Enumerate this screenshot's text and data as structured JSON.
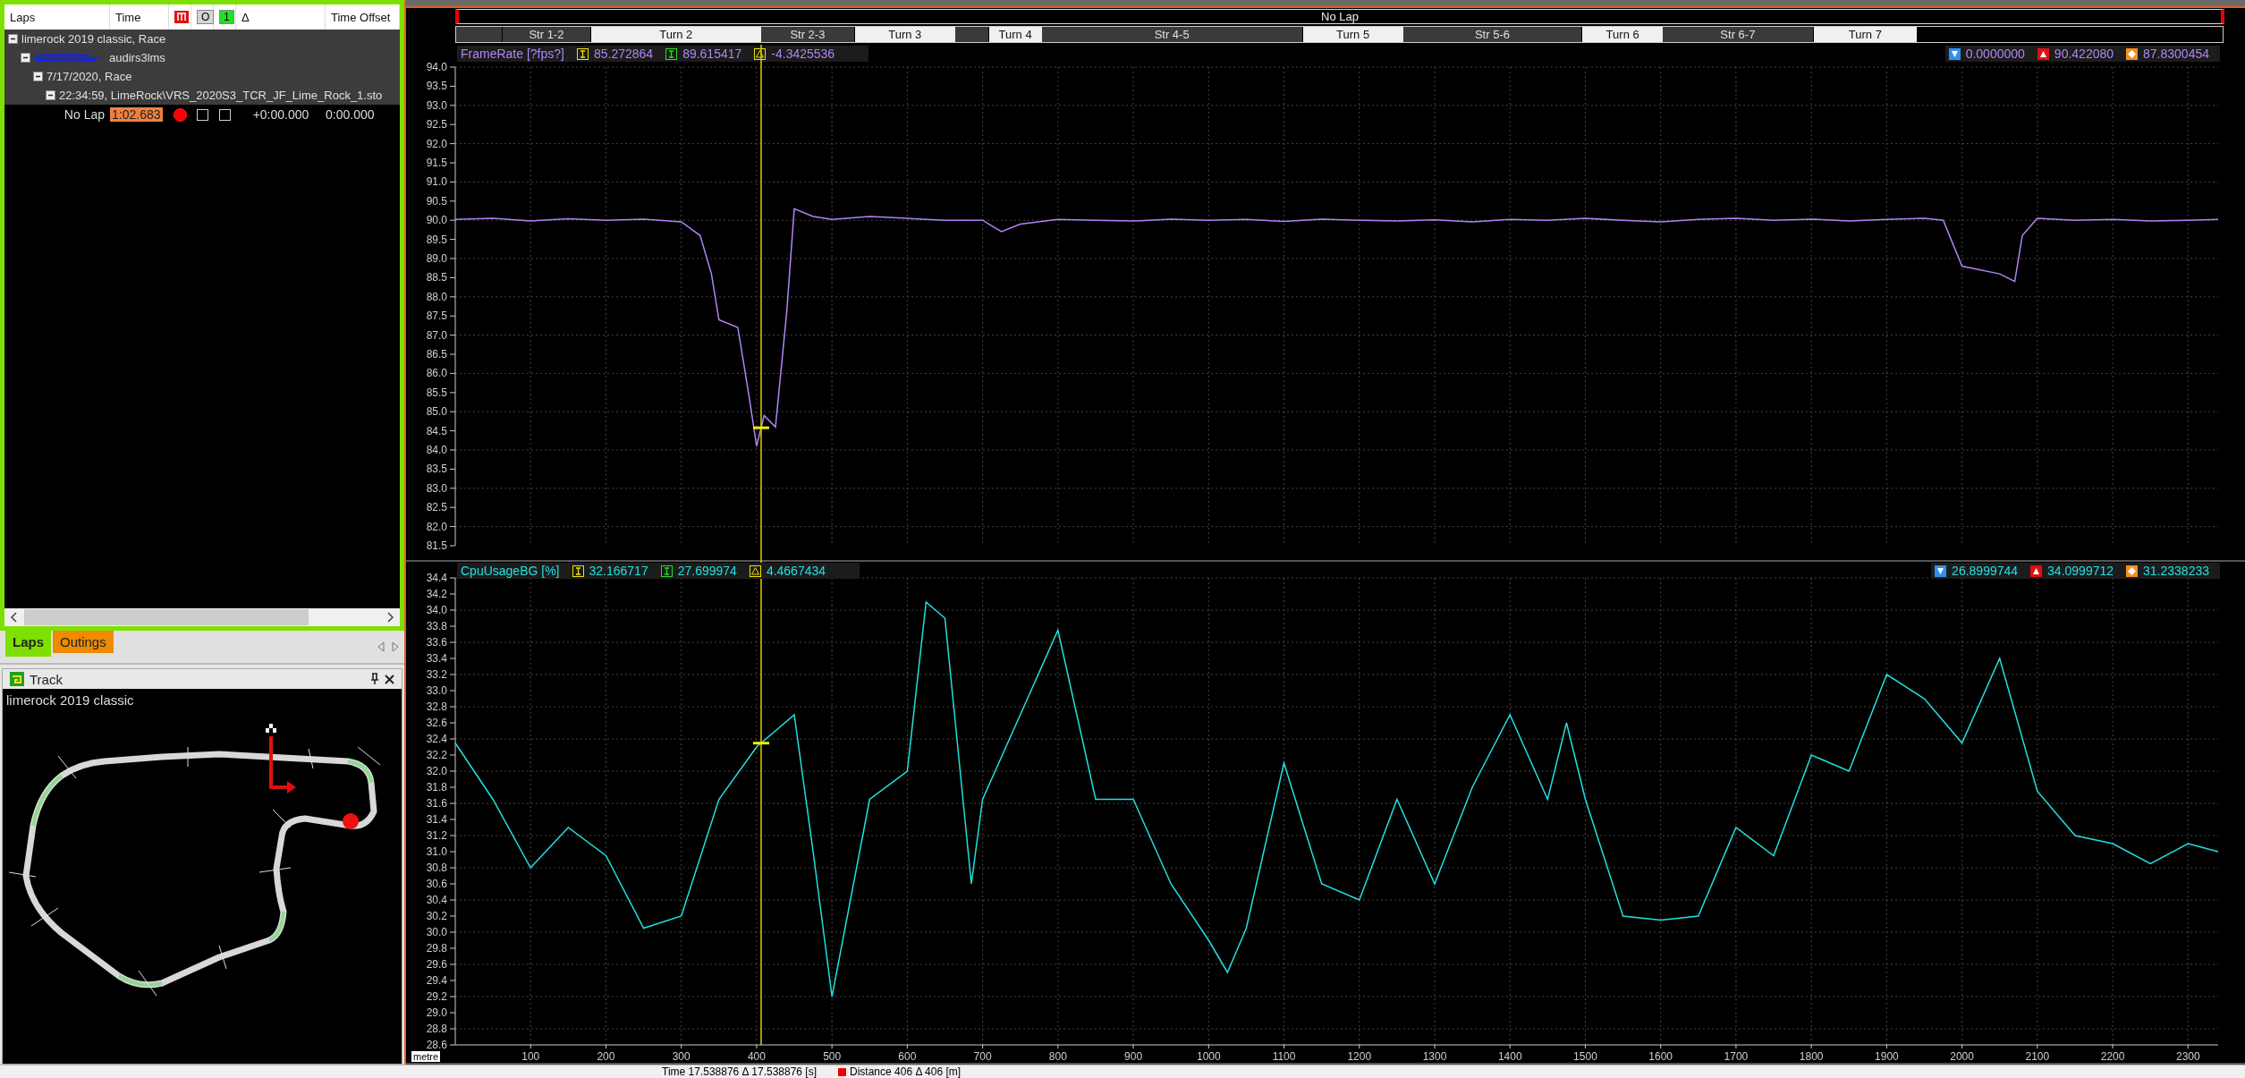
{
  "laps_panel": {
    "columns": [
      {
        "kind": "text",
        "label": "Laps"
      },
      {
        "kind": "text",
        "label": "Time"
      },
      {
        "kind": "icon"
      },
      {
        "kind": "boxed",
        "label": "O",
        "color": "#d4d4d4"
      },
      {
        "kind": "boxed",
        "label": "1",
        "color": "#22e022"
      },
      {
        "kind": "text",
        "label": "Δ"
      },
      {
        "kind": "text",
        "label": "Time Offset"
      }
    ],
    "tree": [
      {
        "label": "limerock 2019 classic, Race",
        "expanded": true,
        "children": [
          {
            "label": "audirs3lms",
            "redacted": true,
            "expanded": true,
            "children": [
              {
                "label": "7/17/2020, Race",
                "expanded": true,
                "children": [
                  {
                    "label": "22:34:59, LimeRock\\VRS_2020S3_TCR_JF_Lime_Rock_1.sto",
                    "expanded": true
                  }
                ]
              }
            ]
          }
        ]
      }
    ],
    "laps": [
      {
        "name": "No Lap",
        "time": "1:02.683",
        "highlighted": true,
        "shown": true,
        "reference": false,
        "compare": false,
        "delta": "+0:00.000",
        "offset": "0:00.000"
      }
    ]
  },
  "panel_tabs": [
    {
      "label": "Laps",
      "selected": true,
      "color": "#7ee000"
    },
    {
      "label": "Outings",
      "selected": false,
      "color": "#f08a00"
    }
  ],
  "track_panel": {
    "title": "Track",
    "track_name": "limerock 2019 classic"
  },
  "lap_bar": {
    "label": "No Lap"
  },
  "segments": [
    {
      "kind": "straight"
    },
    {
      "kind": "straight",
      "label": "Str 1-2"
    },
    {
      "kind": "turn",
      "label": "Turn 2"
    },
    {
      "kind": "straight",
      "label": "Str 2-3"
    },
    {
      "kind": "turn",
      "label": "Turn 3"
    },
    {
      "kind": "straight"
    },
    {
      "kind": "turn",
      "label": "Turn 4"
    },
    {
      "kind": "straight",
      "label": "Str 4-5"
    },
    {
      "kind": "turn",
      "label": "Turn 5"
    },
    {
      "kind": "straight",
      "label": "Str 5-6"
    },
    {
      "kind": "turn",
      "label": "Turn 6"
    },
    {
      "kind": "straight",
      "label": "Str 6-7"
    },
    {
      "kind": "turn",
      "label": "Turn 7"
    },
    {
      "kind": "empty"
    }
  ],
  "charts": [
    {
      "readouts": [
        {
          "kind": "cursor1",
          "value": "85.272864"
        },
        {
          "kind": "cursor2",
          "value": "89.615417"
        },
        {
          "kind": "delta",
          "value": "-4.3425536"
        }
      ],
      "stats": [
        {
          "kind": "min",
          "value": "0.0000000"
        },
        {
          "kind": "max",
          "value": "90.422080"
        },
        {
          "kind": "avg",
          "value": "87.8300454"
        }
      ],
      "chart_data": {
        "type": "line",
        "x": [
          0,
          50,
          100,
          150,
          200,
          250,
          300,
          325,
          340,
          350,
          375,
          390,
          400,
          410,
          425,
          440,
          450,
          475,
          500,
          550,
          600,
          650,
          700,
          725,
          750,
          800,
          850,
          900,
          950,
          1000,
          1050,
          1100,
          1150,
          1200,
          1250,
          1300,
          1350,
          1400,
          1450,
          1500,
          1550,
          1600,
          1650,
          1700,
          1750,
          1800,
          1850,
          1900,
          1950,
          1975,
          2000,
          2050,
          2070,
          2080,
          2100,
          2150,
          2200,
          2250,
          2300,
          2340
        ],
        "series": [
          {
            "name": "FrameRate [?fps?]",
            "color": "#b084f5",
            "values": [
              90.02,
              90.05,
              89.98,
              90.04,
              90.0,
              90.03,
              89.96,
              89.6,
              88.6,
              87.4,
              87.2,
              85.4,
              84.1,
              84.9,
              84.6,
              87.6,
              90.3,
              90.1,
              90.02,
              90.1,
              90.05,
              90.0,
              90.0,
              89.7,
              89.9,
              90.02,
              90.0,
              89.98,
              90.03,
              90.0,
              90.02,
              89.97,
              90.03,
              90.0,
              89.98,
              90.01,
              89.96,
              90.02,
              90.0,
              90.05,
              90.0,
              89.96,
              90.02,
              90.05,
              90.0,
              90.03,
              89.98,
              90.02,
              90.05,
              90.0,
              88.8,
              88.6,
              88.4,
              89.6,
              90.05,
              90.0,
              90.02,
              89.98,
              90.0,
              90.02
            ]
          }
        ],
        "xlim": [
          0,
          2340
        ],
        "ylim": [
          81.5,
          94.0
        ],
        "grid": true,
        "yticks": [
          {
            "value": 94,
            "label": "94.0"
          },
          {
            "value": 93.5,
            "label": "93.5"
          },
          {
            "value": 93,
            "label": "93.0"
          },
          {
            "value": 92.5,
            "label": "92.5"
          },
          {
            "value": 92,
            "label": "92.0"
          },
          {
            "value": 91.5,
            "label": "91.5"
          },
          {
            "value": 91,
            "label": "91.0"
          },
          {
            "value": 90.5,
            "label": "90.5"
          },
          {
            "value": 90,
            "label": "90.0"
          },
          {
            "value": 89.5,
            "label": "89.5"
          },
          {
            "value": 89,
            "label": "89.0"
          },
          {
            "value": 88.5,
            "label": "88.5"
          },
          {
            "value": 88,
            "label": "88.0"
          },
          {
            "value": 87.5,
            "label": "87.5"
          },
          {
            "value": 87,
            "label": "87.0"
          },
          {
            "value": 86.5,
            "label": "86.5"
          },
          {
            "value": 86,
            "label": "86.0"
          },
          {
            "value": 85.5,
            "label": "85.5"
          },
          {
            "value": 85,
            "label": "85.0"
          },
          {
            "value": 84.5,
            "label": "84.5"
          },
          {
            "value": 84,
            "label": "84.0"
          },
          {
            "value": 83.5,
            "label": "83.5"
          },
          {
            "value": 83,
            "label": "83.0"
          },
          {
            "value": 82.5,
            "label": "82.5"
          },
          {
            "value": 82,
            "label": "82.0"
          },
          {
            "value": 81.5,
            "label": "81.5"
          }
        ]
      }
    },
    {
      "readouts": [
        {
          "kind": "cursor1",
          "value": "32.166717"
        },
        {
          "kind": "cursor2",
          "value": "27.699974"
        },
        {
          "kind": "delta",
          "value": "4.4667434"
        }
      ],
      "stats": [
        {
          "kind": "min",
          "value": "26.8999744"
        },
        {
          "kind": "max",
          "value": "34.0999712"
        },
        {
          "kind": "avg",
          "value": "31.2338233"
        }
      ],
      "chart_data": {
        "type": "line",
        "xlabel": "metre",
        "x": [
          0,
          50,
          100,
          150,
          200,
          250,
          300,
          350,
          400,
          450,
          475,
          500,
          550,
          600,
          625,
          650,
          685,
          700,
          750,
          800,
          850,
          900,
          950,
          1000,
          1025,
          1050,
          1100,
          1150,
          1200,
          1250,
          1300,
          1350,
          1400,
          1450,
          1475,
          1500,
          1550,
          1600,
          1650,
          1700,
          1750,
          1800,
          1850,
          1900,
          1950,
          2000,
          2050,
          2100,
          2150,
          2200,
          2250,
          2300,
          2340
        ],
        "series": [
          {
            "name": "CpuUsageBG [%]",
            "color": "#22e0e0",
            "values": [
              32.35,
              31.65,
              30.8,
              31.3,
              30.95,
              30.05,
              30.2,
              31.65,
              32.3,
              32.7,
              31.0,
              29.2,
              31.65,
              32.0,
              34.1,
              33.9,
              30.6,
              31.65,
              32.7,
              33.75,
              31.65,
              31.65,
              30.6,
              29.9,
              29.5,
              30.05,
              32.1,
              30.6,
              30.4,
              31.65,
              30.6,
              31.8,
              32.7,
              31.65,
              32.6,
              31.65,
              30.2,
              30.15,
              30.2,
              31.3,
              30.95,
              32.2,
              32.0,
              33.2,
              32.9,
              32.35,
              33.4,
              31.75,
              31.2,
              31.1,
              30.85,
              31.1,
              31.0
            ]
          }
        ],
        "xlim": [
          0,
          2340
        ],
        "ylim": [
          28.6,
          34.4
        ],
        "grid": true,
        "xticks": [
          100,
          200,
          300,
          400,
          500,
          600,
          700,
          800,
          900,
          1000,
          1100,
          1200,
          1300,
          1400,
          1500,
          1600,
          1700,
          1800,
          1900,
          2000,
          2100,
          2200,
          2300
        ],
        "yticks": [
          {
            "value": 34.4,
            "label": "34.4"
          },
          {
            "value": 34.2,
            "label": "34.2"
          },
          {
            "value": 34,
            "label": "34.0"
          },
          {
            "value": 33.8,
            "label": "33.8"
          },
          {
            "value": 33.6,
            "label": "33.6"
          },
          {
            "value": 33.4,
            "label": "33.4"
          },
          {
            "value": 33.2,
            "label": "33.2"
          },
          {
            "value": 33,
            "label": "33.0"
          },
          {
            "value": 32.8,
            "label": "32.8"
          },
          {
            "value": 32.6,
            "label": "32.6"
          },
          {
            "value": 32.4,
            "label": "32.4"
          },
          {
            "value": 32.2,
            "label": "32.2"
          },
          {
            "value": 32,
            "label": "32.0"
          },
          {
            "value": 31.8,
            "label": "31.8"
          },
          {
            "value": 31.6,
            "label": "31.6"
          },
          {
            "value": 31.4,
            "label": "31.4"
          },
          {
            "value": 31.2,
            "label": "31.2"
          },
          {
            "value": 31,
            "label": "31.0"
          },
          {
            "value": 30.8,
            "label": "30.8"
          },
          {
            "value": 30.6,
            "label": "30.6"
          },
          {
            "value": 30.4,
            "label": "30.4"
          },
          {
            "value": 30.2,
            "label": "30.2"
          },
          {
            "value": 30,
            "label": "30.0"
          },
          {
            "value": 29.8,
            "label": "29.8"
          },
          {
            "value": 29.6,
            "label": "29.6"
          },
          {
            "value": 29.4,
            "label": "29.4"
          },
          {
            "value": 29.2,
            "label": "29.2"
          },
          {
            "value": 29,
            "label": "29.0"
          },
          {
            "value": 28.8,
            "label": "28.8"
          },
          {
            "value": 28.6,
            "label": "28.6"
          }
        ],
        "ref_lines": [
          {
            "axis": "x",
            "value": 406
          }
        ]
      }
    }
  ],
  "status_bar": {
    "time": "Time 17.538876 Δ 17.538876 [s]",
    "distance": "Distance 406 Δ 406 [m]"
  }
}
